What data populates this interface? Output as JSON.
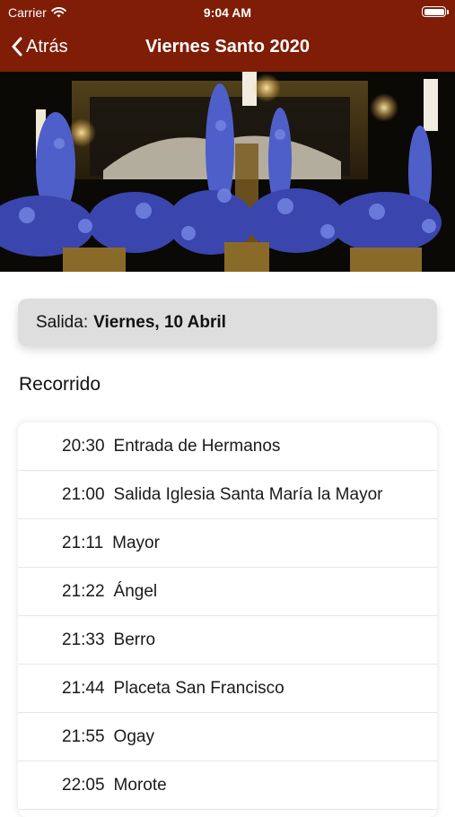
{
  "status_bar": {
    "carrier": "Carrier",
    "time": "9:04 AM"
  },
  "nav": {
    "back_label": "Atrás",
    "title": "Viernes Santo 2020"
  },
  "colors": {
    "header": "#7f1d06",
    "card": "#dedede"
  },
  "salida": {
    "label": "Salida:",
    "value": "Viernes, 10 Abril"
  },
  "recorrido": {
    "title": "Recorrido",
    "stops": [
      {
        "time": "20:30",
        "place": "Entrada de Hermanos"
      },
      {
        "time": "21:00",
        "place": "Salida Iglesia Santa María la Mayor"
      },
      {
        "time": "21:11",
        "place": "Mayor"
      },
      {
        "time": "21:22",
        "place": "Ángel"
      },
      {
        "time": "21:33",
        "place": "Berro"
      },
      {
        "time": "21:44",
        "place": "Placeta San Francisco"
      },
      {
        "time": "21:55",
        "place": "Ogay"
      },
      {
        "time": "22:05",
        "place": "Morote"
      }
    ]
  }
}
